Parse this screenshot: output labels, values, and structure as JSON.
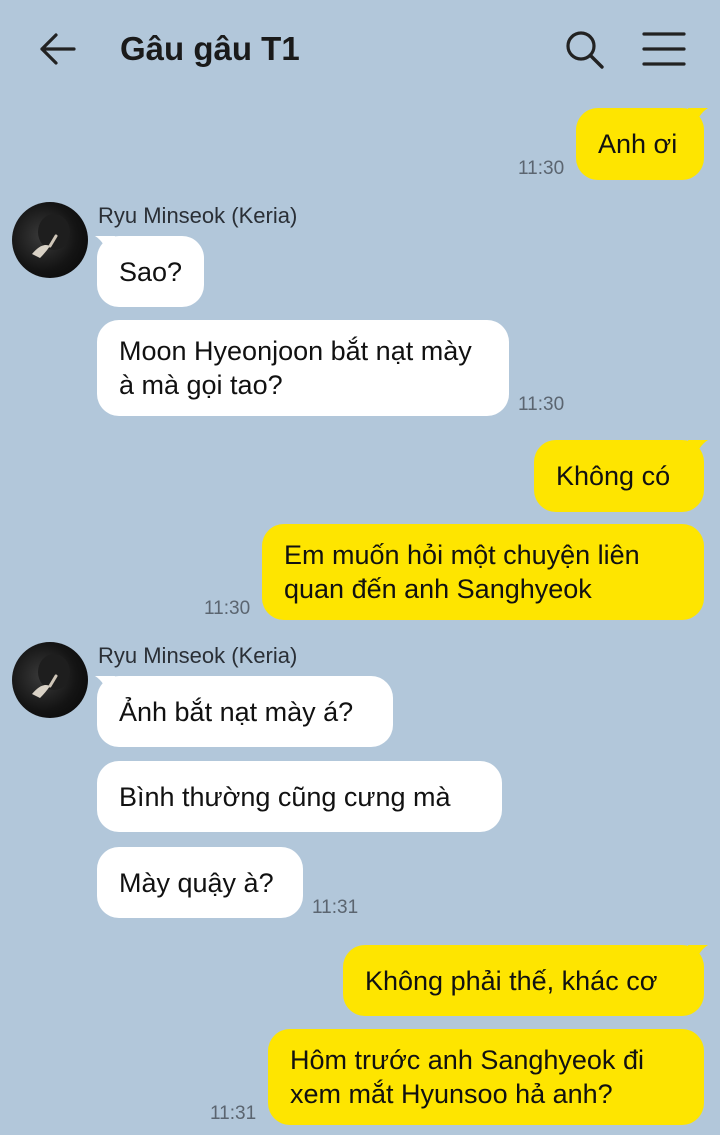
{
  "header": {
    "title": "Gâu gâu T1",
    "back_icon": "arrow-left-icon",
    "search_icon": "search-icon",
    "menu_icon": "hamburger-menu-icon"
  },
  "colors": {
    "background": "#b2c7da",
    "my_bubble": "#fee500",
    "other_bubble": "#ffffff"
  },
  "messages": [
    {
      "from": "me",
      "text": "Anh ơi",
      "time": "11:30"
    },
    {
      "from": "other",
      "sender": "Ryu Minseok (Keria)",
      "text": "Sao?"
    },
    {
      "from": "other",
      "text": "Moon Hyeonjoon bắt nạt mày à mà gọi tao?",
      "time": "11:30"
    },
    {
      "from": "me",
      "text": "Không có"
    },
    {
      "from": "me",
      "text": "Em muốn hỏi một chuyện liên quan đến anh Sanghyeok",
      "time": "11:30"
    },
    {
      "from": "other",
      "sender": "Ryu Minseok (Keria)",
      "text": "Ảnh bắt nạt mày á?"
    },
    {
      "from": "other",
      "text": "Bình thường cũng cưng mà"
    },
    {
      "from": "other",
      "text": "Mày quậy à?",
      "time": "11:31"
    },
    {
      "from": "me",
      "text": "Không phải thế, khác cơ"
    },
    {
      "from": "me",
      "text": "Hôm trước anh Sanghyeok đi xem mắt Hyunsoo hả anh?",
      "time": "11:31"
    }
  ]
}
